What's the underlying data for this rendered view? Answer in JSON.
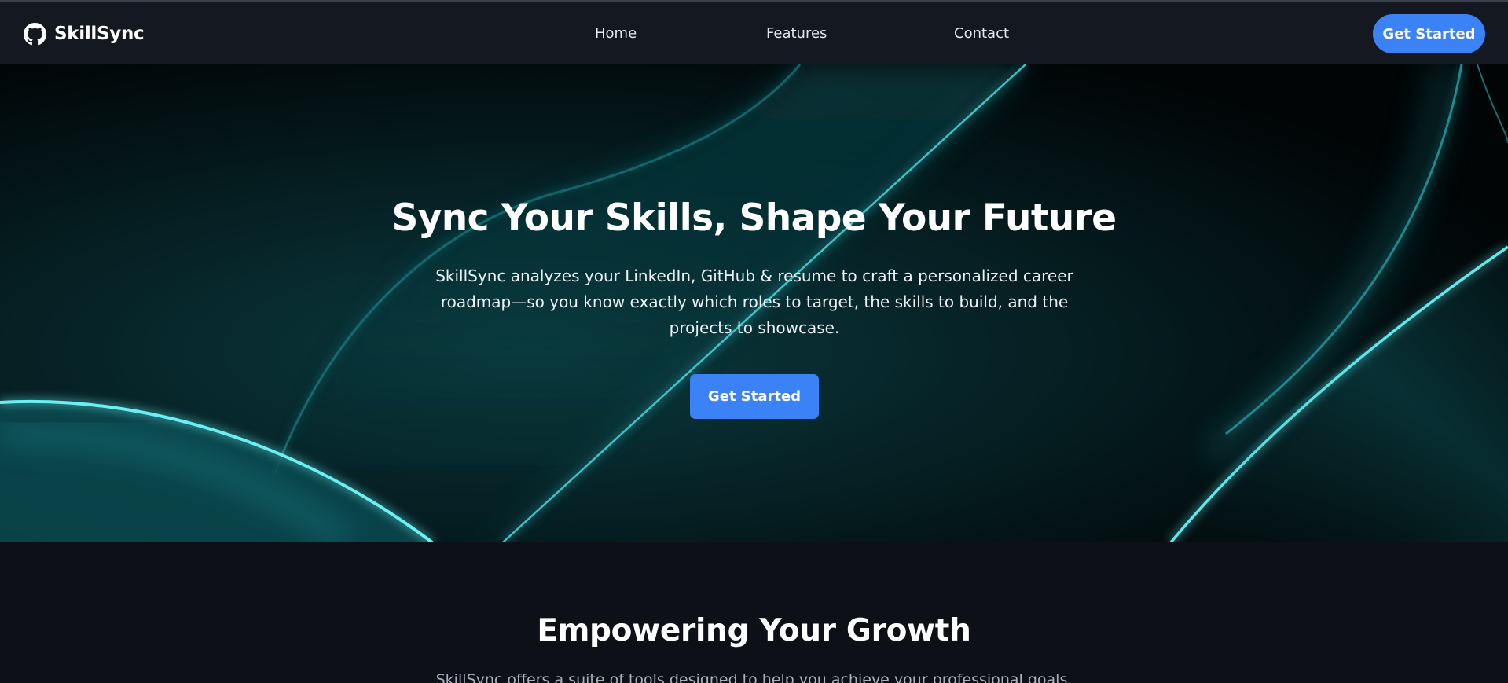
{
  "navbar": {
    "brand_name": "SkillSync",
    "brand_icon": "github-icon",
    "links": [
      {
        "label": "Home"
      },
      {
        "label": "Features"
      },
      {
        "label": "Contact"
      }
    ],
    "cta_label": "Get Started",
    "background": "#141821"
  },
  "hero": {
    "title": "Sync Your Skills, Shape Your Future",
    "subtitle": "SkillSync analyzes your LinkedIn, GitHub & resume to craft a personalized career roadmap—so you know exactly which roles to target, the skills to build, and the projects to showcase.",
    "cta_label": "Get Started",
    "accent_color": "#3b82f6",
    "glow_color": "#3fe0e8"
  },
  "features_section": {
    "title": "Empowering Your Growth",
    "subtitle": "SkillSync offers a suite of tools designed to help you achieve your professional goals."
  }
}
